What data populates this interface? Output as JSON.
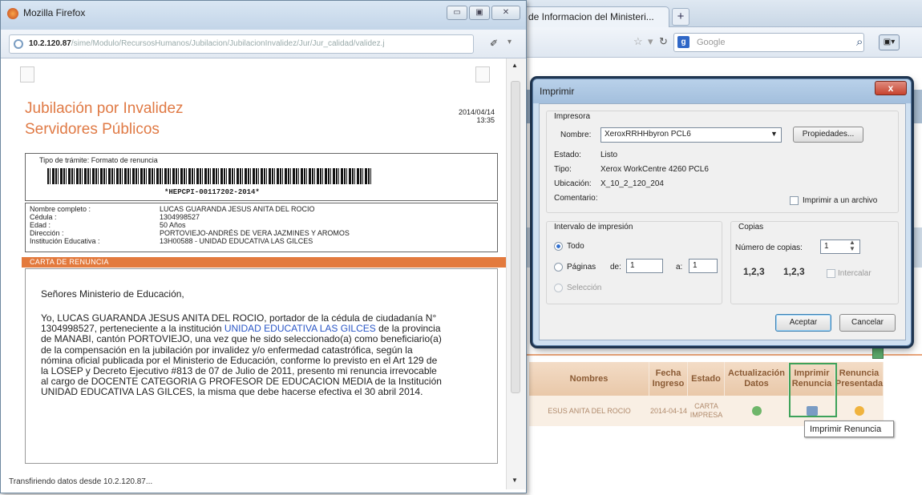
{
  "background_window": {
    "tab_label": "de Informacion del Ministeri...",
    "new_tab_symbol": "+",
    "search_engine": "Google",
    "table": {
      "headers": [
        "Nombres",
        "Fecha Ingreso",
        "Estado",
        "Actualización Datos",
        "Imprimir Renuncia",
        "Renuncia Presentada"
      ],
      "row": {
        "nombre": "ESUS ANITA DEL ROCIO",
        "fecha": "2014-04-14",
        "estado": "CARTA IMPRESA"
      }
    },
    "tooltip": "Imprimir Renuncia"
  },
  "print_dialog": {
    "title": "Imprimir",
    "close_symbol": "x",
    "printer_section": "Impresora",
    "name_label": "Nombre:",
    "printer_name": "XeroxRRHHbyron PCL6",
    "properties_button": "Propiedades...",
    "status_label": "Estado:",
    "status_value": "Listo",
    "type_label": "Tipo:",
    "type_value": "Xerox WorkCentre 4260 PCL6",
    "location_label": "Ubicación:",
    "location_value": "X_10_2_120_204",
    "comment_label": "Comentario:",
    "print_to_file": "Imprimir a un archivo",
    "range_section": "Intervalo de impresión",
    "range_all": "Todo",
    "range_pages": "Páginas",
    "from_label": "de:",
    "from_value": "1",
    "to_label": "a:",
    "to_value": "1",
    "range_selection": "Selección",
    "copies_section": "Copias",
    "copies_label": "Número de copias:",
    "copies_value": "1",
    "collate_label": "Intercalar",
    "collate_glyph": "1,2,3",
    "ok_button": "Aceptar",
    "cancel_button": "Cancelar"
  },
  "popup": {
    "title": "Mozilla Firefox",
    "url_host": "10.2.120.87",
    "url_path": "/sime/Modulo/RecursosHumanos/Jubilacion/JubilacionInvalidez/Jur/Jur_calidad/validez.j",
    "doc_title_1": "Jubilación por Invalidez",
    "doc_title_2": "Servidores Públicos",
    "date": "2014/04/14",
    "time": "13:35",
    "tramite_label": "Tipo de trámite: Formato de renuncia",
    "barcode_text": "*HEPCPI-00117202-2014*",
    "fields": [
      {
        "label": "Nombre completo :",
        "value": "LUCAS GUARANDA JESUS ANITA DEL ROCIO"
      },
      {
        "label": "Cédula :",
        "value": "1304998527"
      },
      {
        "label": "Edad :",
        "value": "50 Años"
      },
      {
        "label": "Dirección :",
        "value": "PORTOVIEJO-ANDRÉS DE VERA JAZMINES Y AROMOS"
      },
      {
        "label": "Institución Educativa :",
        "value": "13H00588 - UNIDAD EDUCATIVA LAS GILCES"
      }
    ],
    "section_header": "CARTA DE RENUNCIA",
    "salutation": "Señores Ministerio de Educación,",
    "letter_lines": [
      {
        "pre": "Yo, LUCAS GUARANDA JESUS ANITA DEL ROCIO, portador de la cédula de ciudadanía N°",
        "hl": "",
        "post": ""
      },
      {
        "pre": "1304998527, perteneciente a la institución ",
        "hl": "UNIDAD EDUCATIVA LAS GILCES",
        "post": " de la provincia"
      },
      {
        "pre": "de MANABI, cantón PORTOVIEJO, una vez que he sido seleccionado(a) como beneficiario(a)",
        "hl": "",
        "post": ""
      },
      {
        "pre": "de la compensación en la jubilación por invalidez y/o enfermedad catastrófica, según la",
        "hl": "",
        "post": ""
      },
      {
        "pre": "nómina oficial publicada por el Ministerio de Educación, conforme lo previsto en el Art 129 de",
        "hl": "",
        "post": ""
      },
      {
        "pre": "la LOSEP y Decreto Ejecutivo #813 de 07 de Julio de 2011, presento mi renuncia irrevocable",
        "hl": "",
        "post": ""
      },
      {
        "pre": "al cargo de DOCENTE CATEGORIA G PROFESOR DE EDUCACION MEDIA de la Institución",
        "hl": "",
        "post": ""
      },
      {
        "pre": "UNIDAD EDUCATIVA LAS GILCES, la misma que debe hacerse efectiva el 30 abril 2014.",
        "hl": "",
        "post": ""
      }
    ],
    "status_text": "Transfiriendo datos desde 10.2.120.87..."
  }
}
